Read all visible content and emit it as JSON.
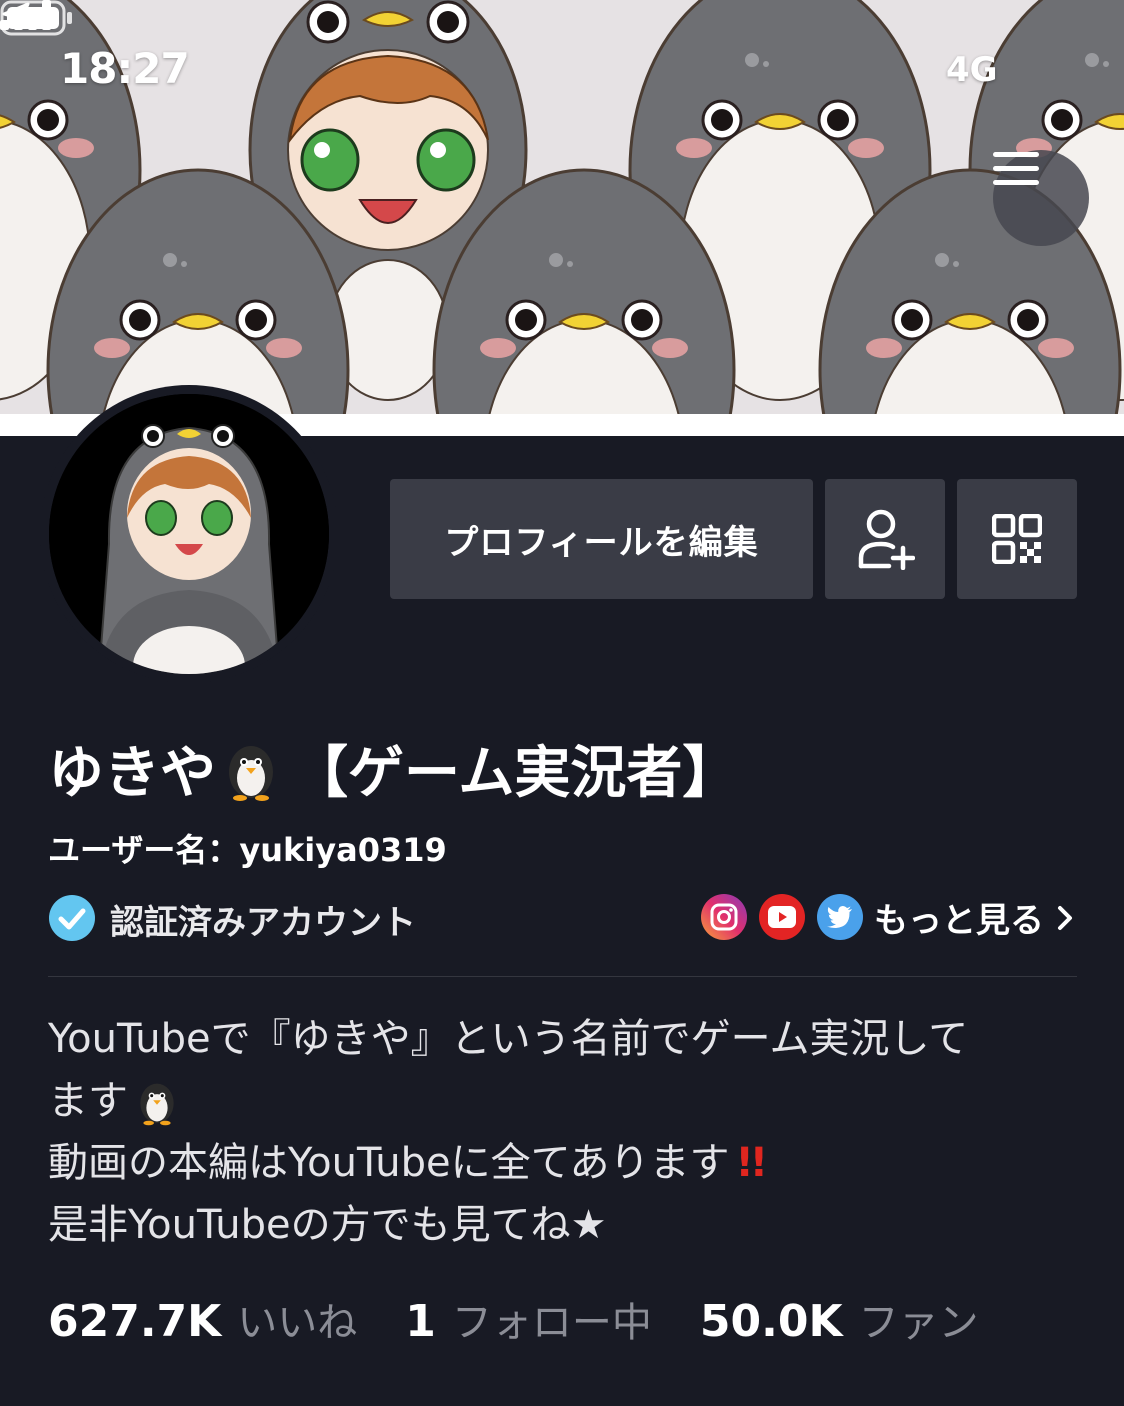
{
  "status_bar": {
    "time": "18:27",
    "network": "4G"
  },
  "profile": {
    "edit_button_label": "プロフィールを編集",
    "display_name_prefix": "ゆきや",
    "display_name_suffix": "【ゲーム実況者】",
    "username_line": "ユーザー名：yukiya0319",
    "verified_label": "認証済みアカウント",
    "more_label": "もっと見る"
  },
  "bio": {
    "line1": "YouTubeで『ゆきや』という名前でゲーム実況して",
    "line2": "ます",
    "line3": "動画の本編はYouTubeに全てあります",
    "line3_emphasis": "!!",
    "line4": "是非YouTubeの方でも見てね★"
  },
  "stats": {
    "likes_value": "627.7K",
    "likes_label": "いいね",
    "following_value": "1",
    "following_label": "フォロー中",
    "fans_value": "50.0K",
    "fans_label": "ファン"
  },
  "icons": {
    "menu": "hamburger-menu-icon",
    "add_friend": "add-friend-icon",
    "qr": "qr-code-icon",
    "verified": "verified-check-icon",
    "instagram": "instagram-icon",
    "youtube": "youtube-icon",
    "twitter": "twitter-icon"
  },
  "colors": {
    "background": "#181a24",
    "button": "#3a3c46",
    "verified": "#63c6f0",
    "emphasis": "#e0261f",
    "stat_label": "#8b8d96"
  }
}
